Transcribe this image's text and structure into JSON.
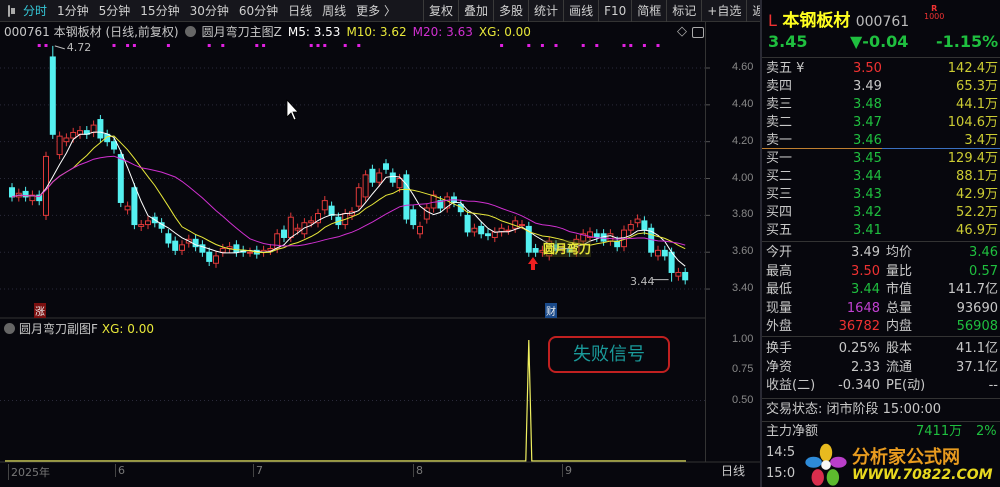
{
  "toolbar": {
    "periods": [
      "分时",
      "1分钟",
      "5分钟",
      "15分钟",
      "30分钟",
      "60分钟",
      "日线",
      "周线",
      "更多 〉"
    ],
    "buttons": [
      "复权",
      "叠加",
      "多股",
      "统计",
      "画线",
      "F10",
      "简框",
      "标记",
      "+自选",
      "返回"
    ]
  },
  "legend": {
    "stock": "000761 本钢板材 (日线,前复权)",
    "indicator": "圆月弯刀主图Z",
    "m5": "M5: 3.53",
    "m10": "M10: 3.62",
    "m20": "M20: 3.63",
    "xg": "XG: 0.00"
  },
  "sub_legend": {
    "indicator": "圆月弯刀副图F",
    "xg": "XG: 0.00"
  },
  "y_axis": [
    "4.60",
    "4.40",
    "4.20",
    "4.00",
    "3.80",
    "3.60",
    "3.40"
  ],
  "sub_y_axis": [
    "1.00",
    "0.75",
    "0.50"
  ],
  "x_axis": [
    "2025年",
    "6",
    "7",
    "8",
    "9"
  ],
  "period_tab": "日线",
  "annotations": {
    "high": "4.72",
    "low": "3.44",
    "signal": "圆月弯刀",
    "fail_signal": "失败信号",
    "marker_zhang": "涨",
    "marker_cai": "财"
  },
  "colors": {
    "up": "#e03a3a",
    "down": "#54f0f0",
    "ma5": "#ffffff",
    "ma10": "#e8e83a",
    "ma20": "#d030d0",
    "signal_dot": "#e020e0",
    "xg": "#f0f060"
  },
  "candles": [
    [
      3.95,
      3.9
    ],
    [
      3.9,
      3.92
    ],
    [
      3.93,
      3.9
    ],
    [
      3.88,
      3.91
    ],
    [
      3.91,
      3.88
    ],
    [
      3.8,
      4.12
    ],
    [
      4.66,
      4.24
    ],
    [
      4.13,
      4.23
    ],
    [
      4.2,
      4.22
    ],
    [
      4.22,
      4.25
    ],
    [
      4.24,
      4.26
    ],
    [
      4.26,
      4.24
    ],
    [
      4.25,
      4.29
    ],
    [
      4.32,
      4.22
    ],
    [
      4.24,
      4.2
    ],
    [
      4.2,
      4.16
    ],
    [
      4.13,
      3.87
    ],
    [
      3.83,
      3.85
    ],
    [
      3.95,
      3.75
    ],
    [
      3.74,
      3.75
    ],
    [
      3.75,
      3.77
    ],
    [
      3.79,
      3.76
    ],
    [
      3.76,
      3.73
    ],
    [
      3.7,
      3.65
    ],
    [
      3.66,
      3.61
    ],
    [
      3.61,
      3.64
    ],
    [
      3.65,
      3.67
    ],
    [
      3.67,
      3.63
    ],
    [
      3.64,
      3.6
    ],
    [
      3.6,
      3.55
    ],
    [
      3.54,
      3.58
    ],
    [
      3.6,
      3.62
    ],
    [
      3.62,
      3.63
    ],
    [
      3.64,
      3.6
    ],
    [
      3.61,
      3.6
    ],
    [
      3.6,
      3.6
    ],
    [
      3.61,
      3.59
    ],
    [
      3.6,
      3.61
    ],
    [
      3.61,
      3.62
    ],
    [
      3.62,
      3.7
    ],
    [
      3.72,
      3.68
    ],
    [
      3.68,
      3.79
    ],
    [
      3.72,
      3.73
    ],
    [
      3.7,
      3.76
    ],
    [
      3.76,
      3.77
    ],
    [
      3.76,
      3.81
    ],
    [
      3.83,
      3.88
    ],
    [
      3.85,
      3.8
    ],
    [
      3.79,
      3.75
    ],
    [
      3.75,
      3.81
    ],
    [
      3.8,
      3.82
    ],
    [
      3.85,
      3.95
    ],
    [
      3.9,
      4.02
    ],
    [
      4.05,
      3.98
    ],
    [
      3.98,
      4.03
    ],
    [
      4.08,
      4.05
    ],
    [
      4.03,
      3.98
    ],
    [
      3.95,
      4.0
    ],
    [
      4.02,
      3.78
    ],
    [
      3.83,
      3.75
    ],
    [
      3.7,
      3.74
    ],
    [
      3.78,
      3.84
    ],
    [
      3.84,
      3.91
    ],
    [
      3.88,
      3.84
    ],
    [
      3.84,
      3.9
    ],
    [
      3.9,
      3.87
    ],
    [
      3.86,
      3.82
    ],
    [
      3.8,
      3.71
    ],
    [
      3.71,
      3.73
    ],
    [
      3.74,
      3.7
    ],
    [
      3.7,
      3.69
    ],
    [
      3.68,
      3.71
    ],
    [
      3.71,
      3.73
    ],
    [
      3.72,
      3.72
    ],
    [
      3.73,
      3.77
    ],
    [
      3.75,
      3.75
    ],
    [
      3.74,
      3.6
    ],
    [
      3.62,
      3.6
    ],
    [
      3.6,
      3.61
    ],
    [
      3.58,
      3.66
    ],
    [
      3.64,
      3.61
    ],
    [
      3.62,
      3.62
    ],
    [
      3.62,
      3.6
    ],
    [
      3.6,
      3.67
    ],
    [
      3.66,
      3.7
    ],
    [
      3.68,
      3.71
    ],
    [
      3.7,
      3.68
    ],
    [
      3.7,
      3.66
    ],
    [
      3.66,
      3.7
    ],
    [
      3.66,
      3.63
    ],
    [
      3.63,
      3.72
    ],
    [
      3.72,
      3.75
    ],
    [
      3.76,
      3.78
    ],
    [
      3.77,
      3.72
    ],
    [
      3.73,
      3.6
    ],
    [
      3.58,
      3.61
    ],
    [
      3.61,
      3.58
    ],
    [
      3.6,
      3.49
    ],
    [
      3.47,
      3.49
    ],
    [
      3.49,
      3.45
    ]
  ],
  "spike_high": {
    "index": 6,
    "value": 4.72
  },
  "low_mark": {
    "index": 97,
    "value": 3.44
  },
  "signal_index": 76,
  "top_signal_indices": [
    4,
    5,
    15,
    17,
    18,
    23,
    29,
    31,
    36,
    37,
    44,
    45,
    46,
    49,
    51,
    72,
    76,
    78,
    80,
    84,
    86,
    90,
    91,
    93,
    95
  ],
  "xg_series": {
    "spike_index": 76,
    "value": 1
  },
  "quote": {
    "prefix": "L",
    "name": "本钢板材",
    "code": "000761",
    "badge_top": "R",
    "badge_bottom": "1000",
    "price": "3.45",
    "change": "▼-0.04",
    "pct": "-1.15%"
  },
  "order_book": [
    {
      "label": "卖五 ¥",
      "price": "3.50",
      "vol": "142.4万",
      "pc": "r"
    },
    {
      "label": "卖四",
      "price": "3.49",
      "vol": "65.3万",
      "pc": "w"
    },
    {
      "label": "卖三",
      "price": "3.48",
      "vol": "44.1万",
      "pc": "g"
    },
    {
      "label": "卖二",
      "price": "3.47",
      "vol": "104.6万",
      "pc": "g"
    },
    {
      "label": "卖一",
      "price": "3.46",
      "vol": "3.4万",
      "pc": "g"
    },
    {
      "label": "买一",
      "price": "3.45",
      "vol": "129.4万",
      "pc": "g"
    },
    {
      "label": "买二",
      "price": "3.44",
      "vol": "88.1万",
      "pc": "g"
    },
    {
      "label": "买三",
      "price": "3.43",
      "vol": "42.9万",
      "pc": "g"
    },
    {
      "label": "买四",
      "price": "3.42",
      "vol": "52.2万",
      "pc": "g"
    },
    {
      "label": "买五",
      "price": "3.41",
      "vol": "46.9万",
      "pc": "g"
    }
  ],
  "stats": [
    {
      "l1": "今开",
      "v1": "3.49",
      "c1": "w",
      "l2": "均价",
      "v2": "3.46",
      "c2": "g"
    },
    {
      "l1": "最高",
      "v1": "3.50",
      "c1": "r",
      "l2": "量比",
      "v2": "0.57",
      "c2": "g"
    },
    {
      "l1": "最低",
      "v1": "3.44",
      "c1": "g",
      "l2": "市值",
      "v2": "141.7亿",
      "c2": "w"
    },
    {
      "l1": "现量",
      "v1": "1648",
      "c1": "m",
      "l2": "总量",
      "v2": "93690",
      "c2": "w"
    },
    {
      "l1": "外盘",
      "v1": "36782",
      "c1": "r",
      "l2": "内盘",
      "v2": "56908",
      "c2": "g"
    },
    {
      "l1": "换手",
      "v1": "0.25%",
      "c1": "w",
      "l2": "股本",
      "v2": "41.1亿",
      "c2": "w"
    },
    {
      "l1": "净资",
      "v1": "2.33",
      "c1": "w",
      "l2": "流通",
      "v2": "37.1亿",
      "c2": "w"
    },
    {
      "l1": "收益(二)",
      "v1": "-0.340",
      "c1": "w",
      "l2": "PE(动)",
      "v2": "--",
      "c2": "w"
    }
  ],
  "trade_status": "交易状态: 闭市阶段 15:00:00",
  "fund_flow": {
    "label": "主力净额",
    "value": "7411万",
    "pct": "2%"
  },
  "ticks": [
    "14:5",
    "15:0"
  ],
  "watermark": {
    "title": "分析家公式网",
    "url": "WWW.70822.COM"
  }
}
